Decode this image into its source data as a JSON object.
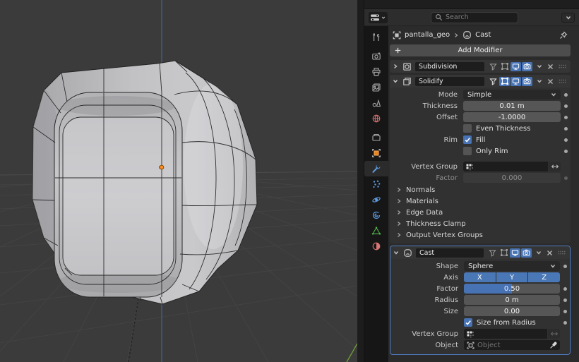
{
  "colors": {
    "accent_blue": "#4772b3",
    "active_panel_outline": "#4f7cc2",
    "object_orange": "#e8841a",
    "origin_orange": "#ff9022",
    "axis_z_blue": "#4166a9",
    "axis_y_green": "#71a038",
    "viewport_bg": "#3b3b3b"
  },
  "header": {
    "search_placeholder": "Search"
  },
  "breadcrumb": {
    "object_name": "pantalla_geo",
    "active_modifier": "Cast"
  },
  "add_modifier_label": "Add Modifier",
  "modifiers": {
    "subdivision": {
      "name": "Subdivision",
      "expanded": false,
      "viewport_on": true,
      "render_on": true
    },
    "solidify": {
      "name": "Solidify",
      "expanded": true,
      "edit_mode_on": true,
      "viewport_on": true,
      "render_on": true,
      "mode": {
        "label": "Mode",
        "value": "Simple"
      },
      "thickness": {
        "label": "Thickness",
        "value": "0.01 m"
      },
      "offset": {
        "label": "Offset",
        "value": "-1.0000"
      },
      "even_thickness": {
        "label": "Even Thickness",
        "checked": false
      },
      "rim": {
        "label": "Rim",
        "fill_label": "Fill",
        "fill_checked": true,
        "only_rim_label": "Only Rim",
        "only_rim_checked": false
      },
      "vertex_group": {
        "label": "Vertex Group",
        "value": ""
      },
      "factor": {
        "label": "Factor",
        "value": "0.000",
        "enabled": false
      },
      "sections": [
        "Normals",
        "Materials",
        "Edge Data",
        "Thickness Clamp",
        "Output Vertex Groups"
      ]
    },
    "cast": {
      "name": "Cast",
      "expanded": true,
      "active": true,
      "viewport_on": true,
      "render_on": true,
      "shape": {
        "label": "Shape",
        "value": "Sphere"
      },
      "axis": {
        "label": "Axis",
        "options": [
          "X",
          "Y",
          "Z"
        ],
        "selected": [
          "X",
          "Y",
          "Z"
        ]
      },
      "factor": {
        "label": "Factor",
        "value": "0.50",
        "fill_ratio": 0.5
      },
      "radius": {
        "label": "Radius",
        "value": "0 m"
      },
      "size": {
        "label": "Size",
        "value": "0.00"
      },
      "size_from_radius": {
        "label": "Size from Radius",
        "checked": true
      },
      "vertex_group": {
        "label": "Vertex Group",
        "value": ""
      },
      "object": {
        "label": "Object",
        "placeholder": "Object"
      }
    }
  },
  "icons": {
    "header": [
      "properties-editor-icon",
      "search-icon",
      "options-chevron-icon"
    ],
    "breadcrumb": [
      "object-icon",
      "chevron-right-icon",
      "cast-modifier-icon",
      "pin-icon"
    ],
    "modifier_header": [
      "expand-chevron-icon",
      "modifier-type-icon",
      "vertex-group-filter-icon",
      "edit-mode-display-icon",
      "viewport-display-icon",
      "render-display-icon",
      "extras-chevron-icon",
      "close-icon",
      "drag-grip-icon"
    ],
    "tabs": [
      "tool",
      "render",
      "output",
      "view-layer",
      "scene",
      "world",
      "collection",
      "object",
      "modifiers",
      "particles",
      "physics",
      "constraints",
      "object-data",
      "material"
    ]
  }
}
